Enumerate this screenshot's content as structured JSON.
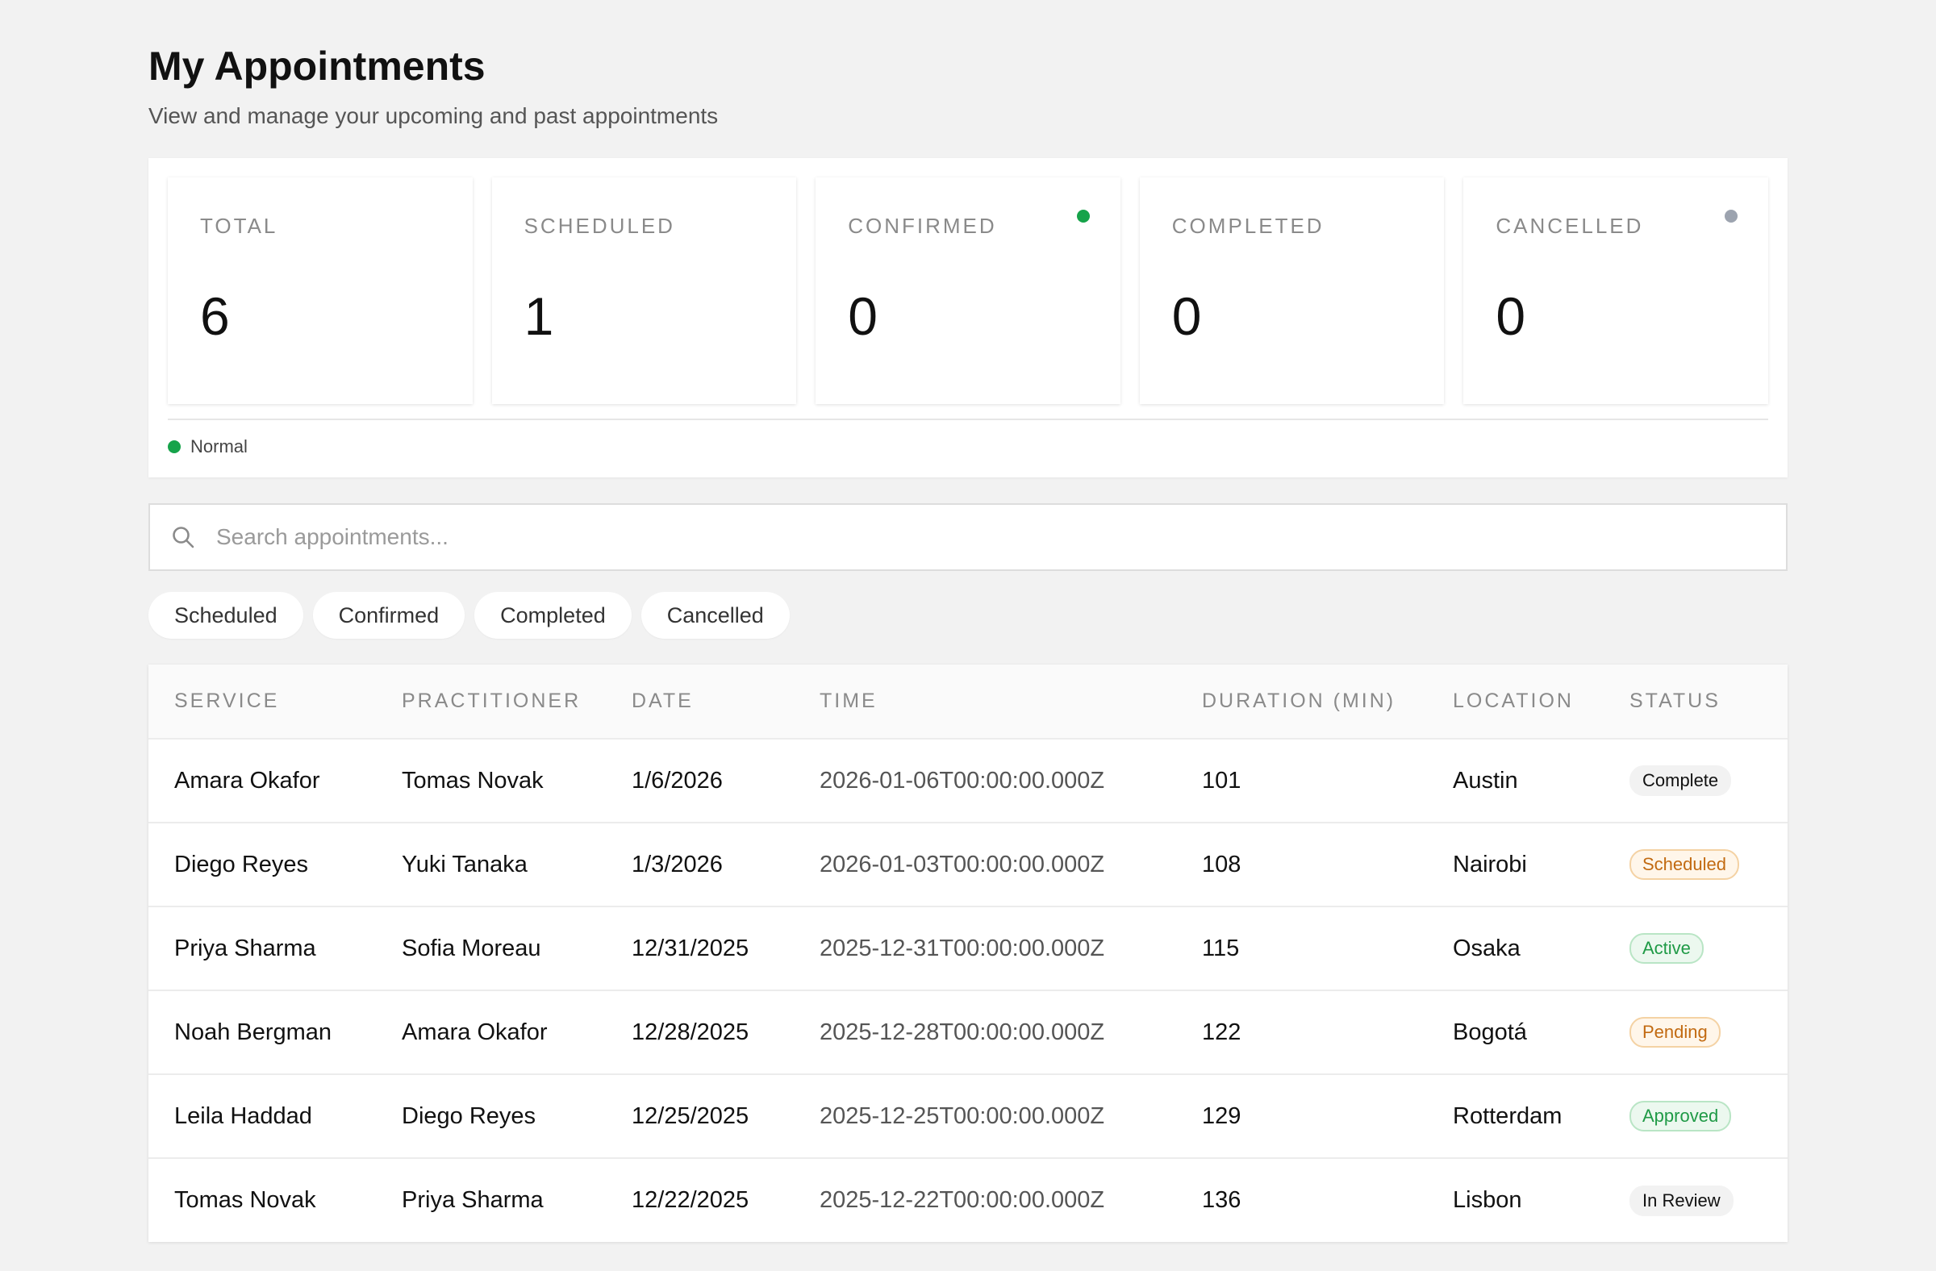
{
  "header": {
    "title": "My Appointments",
    "subtitle": "View and manage your upcoming and past appointments"
  },
  "stats": [
    {
      "label": "TOTAL",
      "value": "6",
      "dot_color": null
    },
    {
      "label": "SCHEDULED",
      "value": "1",
      "dot_color": null
    },
    {
      "label": "CONFIRMED",
      "value": "0",
      "dot_color": "#16a34a"
    },
    {
      "label": "COMPLETED",
      "value": "0",
      "dot_color": null
    },
    {
      "label": "CANCELLED",
      "value": "0",
      "dot_color": "#9ca3af"
    }
  ],
  "legend": {
    "label": "Normal",
    "color": "#16a34a"
  },
  "search": {
    "placeholder": "Search appointments...",
    "value": "",
    "icon": "search-icon"
  },
  "filters": [
    "Scheduled",
    "Confirmed",
    "Completed",
    "Cancelled"
  ],
  "table": {
    "columns": [
      "SERVICE",
      "PRACTITIONER",
      "DATE",
      "TIME",
      "DURATION (MIN)",
      "LOCATION",
      "STATUS"
    ],
    "rows": [
      {
        "service": "Amara Okafor",
        "practitioner": "Tomas Novak",
        "date": "1/6/2026",
        "time": "2026-01-06T00:00:00.000Z",
        "duration": "101",
        "location": "Austin",
        "status": "Complete",
        "status_style": "neutral"
      },
      {
        "service": "Diego Reyes",
        "practitioner": "Yuki Tanaka",
        "date": "1/3/2026",
        "time": "2026-01-03T00:00:00.000Z",
        "duration": "108",
        "location": "Nairobi",
        "status": "Scheduled",
        "status_style": "orange"
      },
      {
        "service": "Priya Sharma",
        "practitioner": "Sofia Moreau",
        "date": "12/31/2025",
        "time": "2025-12-31T00:00:00.000Z",
        "duration": "115",
        "location": "Osaka",
        "status": "Active",
        "status_style": "green"
      },
      {
        "service": "Noah Bergman",
        "practitioner": "Amara Okafor",
        "date": "12/28/2025",
        "time": "2025-12-28T00:00:00.000Z",
        "duration": "122",
        "location": "Bogotá",
        "status": "Pending",
        "status_style": "orange"
      },
      {
        "service": "Leila Haddad",
        "practitioner": "Diego Reyes",
        "date": "12/25/2025",
        "time": "2025-12-25T00:00:00.000Z",
        "duration": "129",
        "location": "Rotterdam",
        "status": "Approved",
        "status_style": "green"
      },
      {
        "service": "Tomas Novak",
        "practitioner": "Priya Sharma",
        "date": "12/22/2025",
        "time": "2025-12-22T00:00:00.000Z",
        "duration": "136",
        "location": "Lisbon",
        "status": "In Review",
        "status_style": "neutral"
      }
    ]
  }
}
